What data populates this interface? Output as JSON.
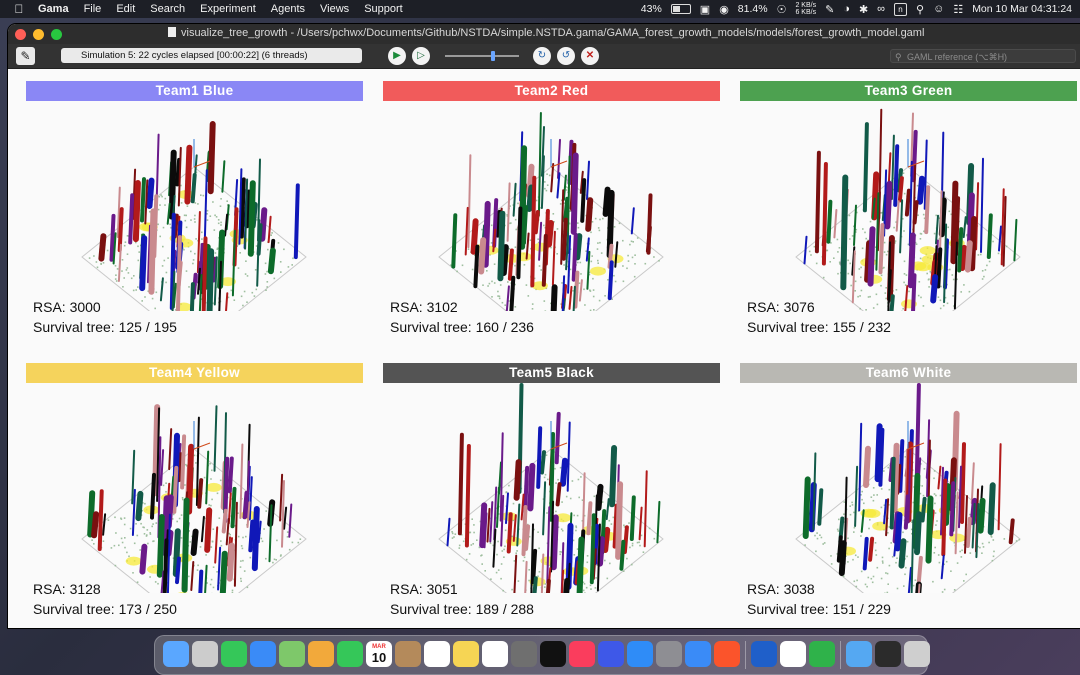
{
  "menubar": {
    "app_name": "Gama",
    "items": [
      "File",
      "Edit",
      "Search",
      "Experiment",
      "Agents",
      "Views",
      "Support"
    ],
    "battery": "43%",
    "cpu": "81.4%",
    "net_up": "2 KB/s",
    "net_down": "6 KB/s",
    "input_indicator": "n",
    "datetime": "Mon 10 Mar  04:31:24"
  },
  "window": {
    "title": "visualize_tree_growth - /Users/pchwx/Documents/Github/NSTDA/simple.NSTDA.gama/GAMA_forest_growth_models/models/forest_growth_model.gaml"
  },
  "toolbar": {
    "status": "Simulation 5: 22 cycles elapsed [00:00:22] (6 threads)",
    "search_placeholder": "GAML reference (⌥⌘H)",
    "speed_level": 0.65
  },
  "panels": [
    {
      "team": "Team1 Blue",
      "color": "#8a87f5",
      "rsa_label": "RSA: 3000",
      "survival_label": "Survival tree: 125 / 195"
    },
    {
      "team": "Team2 Red",
      "color": "#f15b5b",
      "rsa_label": "RSA: 3102",
      "survival_label": "Survival tree: 160 / 236"
    },
    {
      "team": "Team3 Green",
      "color": "#4da150",
      "rsa_label": "RSA: 3076",
      "survival_label": "Survival tree: 155 / 232"
    },
    {
      "team": "Team4 Yellow",
      "color": "#f5d35c",
      "rsa_label": "RSA: 3128",
      "survival_label": "Survival tree: 173 / 250"
    },
    {
      "team": "Team5 Black",
      "color": "#545454",
      "rsa_label": "RSA: 3051",
      "survival_label": "Survival tree: 189 / 288"
    },
    {
      "team": "Team6 White",
      "color": "#b9b8b3",
      "rsa_label": "RSA: 3038",
      "survival_label": "Survival tree: 151 / 229"
    }
  ],
  "tree_colors": [
    "#1018b8",
    "#0d6b2a",
    "#7a1010",
    "#b21a1a",
    "#c98a8e",
    "#0b0b0b",
    "#6a1a8a",
    "#125a48"
  ],
  "dock_apps": [
    "Finder",
    "Launchpad",
    "Messages",
    "Mail",
    "Maps",
    "Photos",
    "FaceTime",
    "Calendar",
    "Contacts",
    "Reminders",
    "Notes",
    "Freeform",
    "iPhone Mirroring",
    "TV",
    "Music",
    "Weverse",
    "App Store",
    "System Settings",
    "Safari",
    "Brave",
    "Word",
    "Grammarly",
    "Numbers",
    "Downloads",
    "Screen Recording",
    "Trash"
  ],
  "dock_calendar": {
    "month": "MAR",
    "day": "10"
  }
}
